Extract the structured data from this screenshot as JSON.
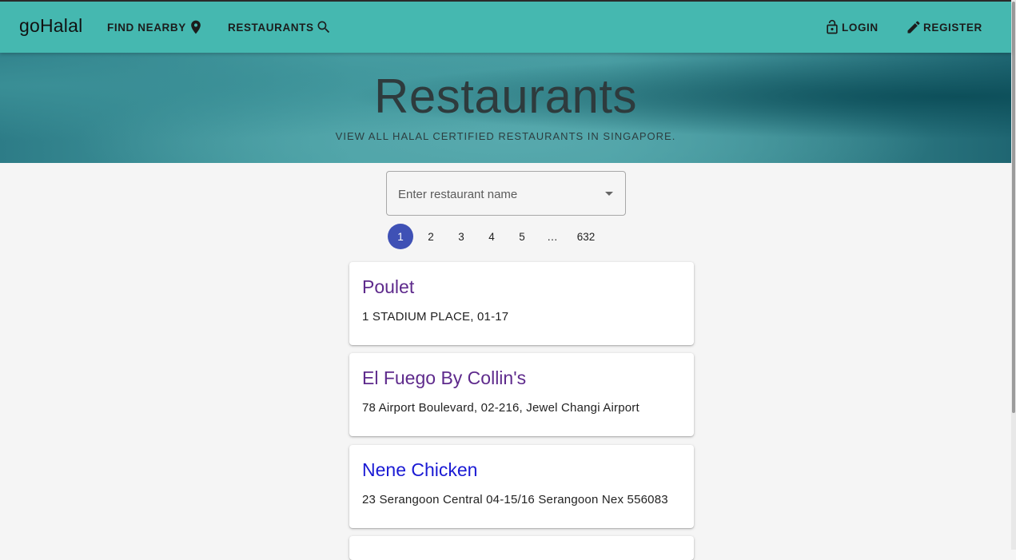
{
  "navbar": {
    "brand": "goHalal",
    "find_nearby": "FIND NEARBY",
    "restaurants": "RESTAURANTS",
    "login": "LOGIN",
    "register": "REGISTER",
    "icons": {
      "find_nearby": "location-pin-icon",
      "restaurants": "search-icon",
      "login": "lock-open-icon",
      "register": "pencil-icon"
    }
  },
  "hero": {
    "title": "Restaurants",
    "subtitle": "VIEW ALL HALAL CERTIFIED RESTAURANTS IN SINGAPORE."
  },
  "search": {
    "placeholder": "Enter restaurant name",
    "value": ""
  },
  "pagination": {
    "current": 1,
    "pages": [
      "1",
      "2",
      "3",
      "4",
      "5",
      "…",
      "632"
    ]
  },
  "restaurants": [
    {
      "name": "Poulet",
      "address": "1 STADIUM PLACE, 01-17",
      "link_color": "#5e2a8c"
    },
    {
      "name": "El Fuego By Collin's",
      "address": "78 Airport Boulevard, 02-216, Jewel Changi Airport",
      "link_color": "#5e2a8c"
    },
    {
      "name": "Nene Chicken",
      "address": "23 Serangoon Central 04-15/16 Serangoon Nex 556083",
      "link_color": "#1a1ad4"
    }
  ],
  "colors": {
    "navbar_bg": "#45b8b0",
    "active_page": "#3f51b5",
    "visited_link": "#5e2a8c",
    "link": "#1a1ad4"
  }
}
